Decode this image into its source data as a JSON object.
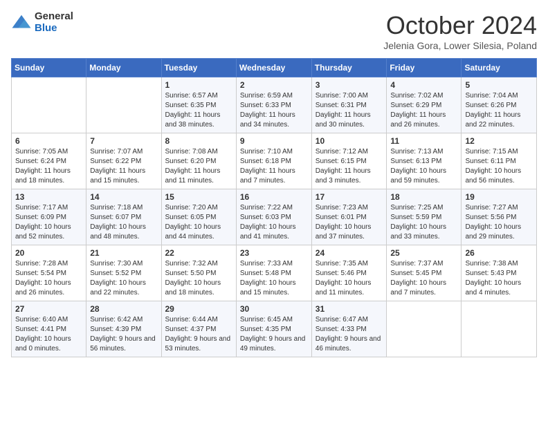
{
  "logo": {
    "general": "General",
    "blue": "Blue"
  },
  "title": "October 2024",
  "location": "Jelenia Gora, Lower Silesia, Poland",
  "days_of_week": [
    "Sunday",
    "Monday",
    "Tuesday",
    "Wednesday",
    "Thursday",
    "Friday",
    "Saturday"
  ],
  "weeks": [
    [
      {
        "day": "",
        "info": ""
      },
      {
        "day": "",
        "info": ""
      },
      {
        "day": "1",
        "info": "Sunrise: 6:57 AM\nSunset: 6:35 PM\nDaylight: 11 hours and 38 minutes."
      },
      {
        "day": "2",
        "info": "Sunrise: 6:59 AM\nSunset: 6:33 PM\nDaylight: 11 hours and 34 minutes."
      },
      {
        "day": "3",
        "info": "Sunrise: 7:00 AM\nSunset: 6:31 PM\nDaylight: 11 hours and 30 minutes."
      },
      {
        "day": "4",
        "info": "Sunrise: 7:02 AM\nSunset: 6:29 PM\nDaylight: 11 hours and 26 minutes."
      },
      {
        "day": "5",
        "info": "Sunrise: 7:04 AM\nSunset: 6:26 PM\nDaylight: 11 hours and 22 minutes."
      }
    ],
    [
      {
        "day": "6",
        "info": "Sunrise: 7:05 AM\nSunset: 6:24 PM\nDaylight: 11 hours and 18 minutes."
      },
      {
        "day": "7",
        "info": "Sunrise: 7:07 AM\nSunset: 6:22 PM\nDaylight: 11 hours and 15 minutes."
      },
      {
        "day": "8",
        "info": "Sunrise: 7:08 AM\nSunset: 6:20 PM\nDaylight: 11 hours and 11 minutes."
      },
      {
        "day": "9",
        "info": "Sunrise: 7:10 AM\nSunset: 6:18 PM\nDaylight: 11 hours and 7 minutes."
      },
      {
        "day": "10",
        "info": "Sunrise: 7:12 AM\nSunset: 6:15 PM\nDaylight: 11 hours and 3 minutes."
      },
      {
        "day": "11",
        "info": "Sunrise: 7:13 AM\nSunset: 6:13 PM\nDaylight: 10 hours and 59 minutes."
      },
      {
        "day": "12",
        "info": "Sunrise: 7:15 AM\nSunset: 6:11 PM\nDaylight: 10 hours and 56 minutes."
      }
    ],
    [
      {
        "day": "13",
        "info": "Sunrise: 7:17 AM\nSunset: 6:09 PM\nDaylight: 10 hours and 52 minutes."
      },
      {
        "day": "14",
        "info": "Sunrise: 7:18 AM\nSunset: 6:07 PM\nDaylight: 10 hours and 48 minutes."
      },
      {
        "day": "15",
        "info": "Sunrise: 7:20 AM\nSunset: 6:05 PM\nDaylight: 10 hours and 44 minutes."
      },
      {
        "day": "16",
        "info": "Sunrise: 7:22 AM\nSunset: 6:03 PM\nDaylight: 10 hours and 41 minutes."
      },
      {
        "day": "17",
        "info": "Sunrise: 7:23 AM\nSunset: 6:01 PM\nDaylight: 10 hours and 37 minutes."
      },
      {
        "day": "18",
        "info": "Sunrise: 7:25 AM\nSunset: 5:59 PM\nDaylight: 10 hours and 33 minutes."
      },
      {
        "day": "19",
        "info": "Sunrise: 7:27 AM\nSunset: 5:56 PM\nDaylight: 10 hours and 29 minutes."
      }
    ],
    [
      {
        "day": "20",
        "info": "Sunrise: 7:28 AM\nSunset: 5:54 PM\nDaylight: 10 hours and 26 minutes."
      },
      {
        "day": "21",
        "info": "Sunrise: 7:30 AM\nSunset: 5:52 PM\nDaylight: 10 hours and 22 minutes."
      },
      {
        "day": "22",
        "info": "Sunrise: 7:32 AM\nSunset: 5:50 PM\nDaylight: 10 hours and 18 minutes."
      },
      {
        "day": "23",
        "info": "Sunrise: 7:33 AM\nSunset: 5:48 PM\nDaylight: 10 hours and 15 minutes."
      },
      {
        "day": "24",
        "info": "Sunrise: 7:35 AM\nSunset: 5:46 PM\nDaylight: 10 hours and 11 minutes."
      },
      {
        "day": "25",
        "info": "Sunrise: 7:37 AM\nSunset: 5:45 PM\nDaylight: 10 hours and 7 minutes."
      },
      {
        "day": "26",
        "info": "Sunrise: 7:38 AM\nSunset: 5:43 PM\nDaylight: 10 hours and 4 minutes."
      }
    ],
    [
      {
        "day": "27",
        "info": "Sunrise: 6:40 AM\nSunset: 4:41 PM\nDaylight: 10 hours and 0 minutes."
      },
      {
        "day": "28",
        "info": "Sunrise: 6:42 AM\nSunset: 4:39 PM\nDaylight: 9 hours and 56 minutes."
      },
      {
        "day": "29",
        "info": "Sunrise: 6:44 AM\nSunset: 4:37 PM\nDaylight: 9 hours and 53 minutes."
      },
      {
        "day": "30",
        "info": "Sunrise: 6:45 AM\nSunset: 4:35 PM\nDaylight: 9 hours and 49 minutes."
      },
      {
        "day": "31",
        "info": "Sunrise: 6:47 AM\nSunset: 4:33 PM\nDaylight: 9 hours and 46 minutes."
      },
      {
        "day": "",
        "info": ""
      },
      {
        "day": "",
        "info": ""
      }
    ]
  ]
}
